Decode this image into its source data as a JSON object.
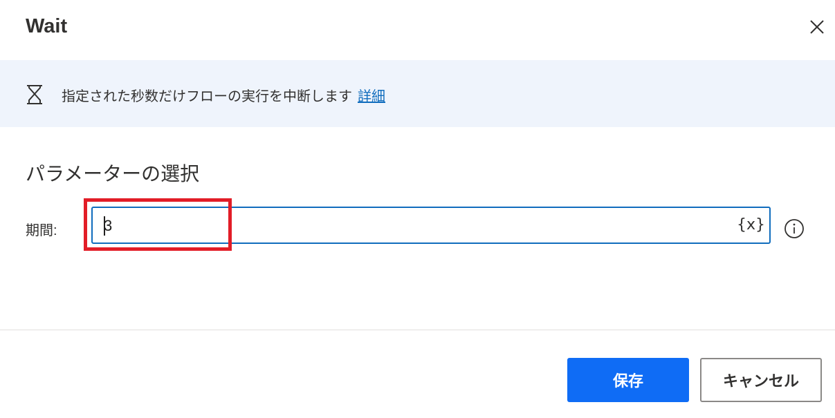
{
  "dialog": {
    "title": "Wait",
    "close_label": "Close"
  },
  "banner": {
    "description": "指定された秒数だけフローの実行を中断します",
    "link_text": "詳細"
  },
  "section": {
    "title": "パラメーターの選択"
  },
  "duration_field": {
    "label": "期間:",
    "value": "3",
    "variable_button": "{x}"
  },
  "footer": {
    "save_label": "保存",
    "cancel_label": "キャンセル"
  },
  "colors": {
    "accent": "#0f6cf5",
    "banner_bg": "#eff4fc",
    "highlight": "#e21d27"
  },
  "icons": {
    "close": "close-icon",
    "banner": "hourglass-icon",
    "info": "info-icon"
  }
}
